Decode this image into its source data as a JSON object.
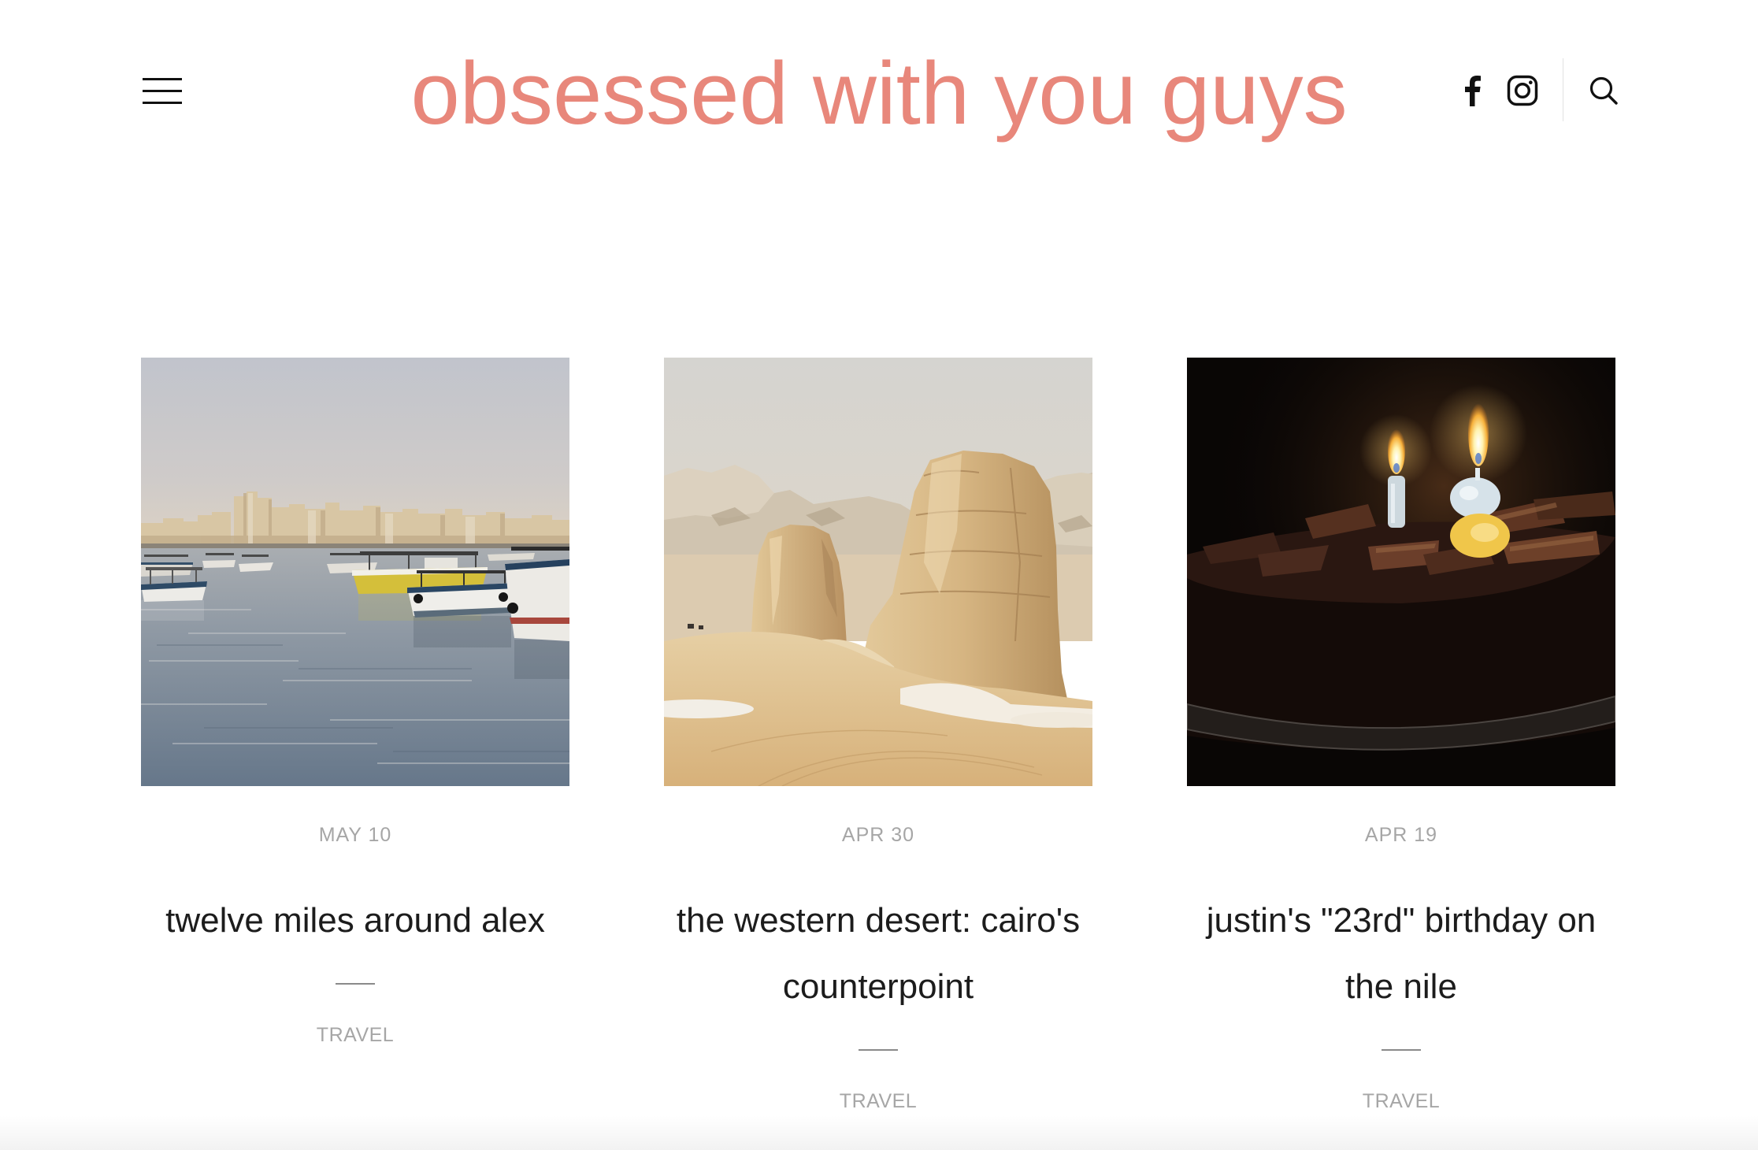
{
  "site": {
    "title": "obsessed with you guys"
  },
  "header": {
    "menu_icon": "hamburger-menu-icon",
    "social_icons": [
      "facebook-icon",
      "instagram-icon"
    ],
    "search_icon": "search-icon"
  },
  "posts": [
    {
      "date": "MAY 10",
      "title": "twelve miles around alex",
      "category": "TRAVEL"
    },
    {
      "date": "APR 30",
      "title": "the western desert: cairo's counterpoint",
      "category": "TRAVEL"
    },
    {
      "date": "APR 19",
      "title": "justin's \"23rd\" birthday on the nile",
      "category": "TRAVEL"
    }
  ],
  "colors": {
    "accent": "#e8877b",
    "text": "#1c1c1c",
    "meta": "#a6a6a6",
    "background": "#ffffff"
  }
}
